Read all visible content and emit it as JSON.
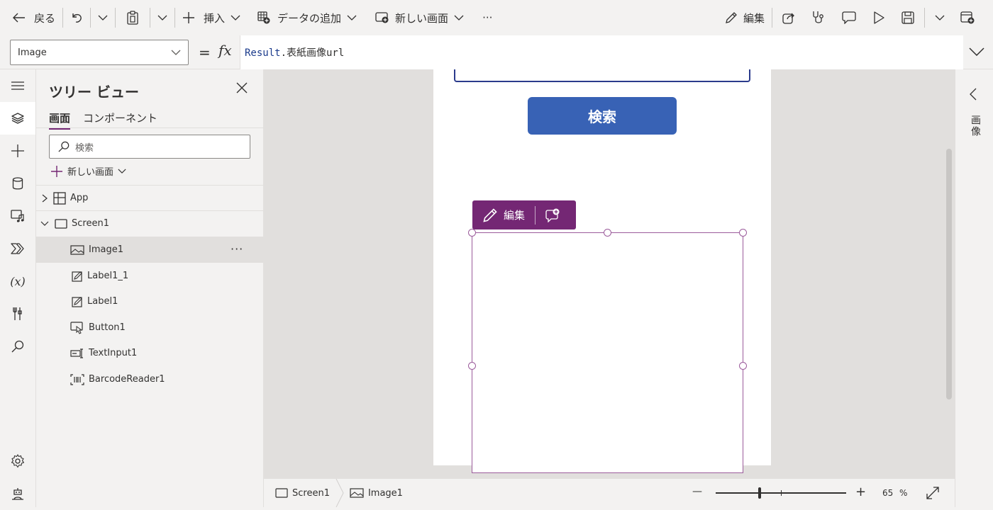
{
  "toolbar": {
    "back_label": "戻る",
    "insert_label": "挿入",
    "add_data_label": "データの追加",
    "new_screen_label": "新しい画面",
    "more_label": "···",
    "edit_label": "編集"
  },
  "formula_bar": {
    "property": "Image",
    "equals": "=",
    "fx": "fx",
    "formula_object": "Result",
    "formula_rest": ".表紙画像url"
  },
  "tree_view": {
    "title": "ツリー ビュー",
    "tabs": [
      {
        "label": "画面",
        "active": true
      },
      {
        "label": "コンポーネント",
        "active": false
      }
    ],
    "search_placeholder": "検索",
    "new_screen_label": "新しい画面",
    "nodes": [
      {
        "label": "App",
        "icon": "app-icon",
        "expanded": false
      },
      {
        "label": "Screen1",
        "icon": "screen-icon",
        "expanded": true
      },
      {
        "label": "Image1",
        "icon": "image-icon",
        "selected": true
      },
      {
        "label": "Label1_1",
        "icon": "label-icon"
      },
      {
        "label": "Label1",
        "icon": "label-icon"
      },
      {
        "label": "Button1",
        "icon": "button-icon"
      },
      {
        "label": "TextInput1",
        "icon": "textinput-icon"
      },
      {
        "label": "BarcodeReader1",
        "icon": "barcode-icon"
      }
    ],
    "more_label": "···"
  },
  "canvas": {
    "search_button_label": "検索",
    "edit_pill_label": "編集"
  },
  "right_pane": {
    "label": "画像"
  },
  "status_bar": {
    "breadcrumb_screen": "Screen1",
    "breadcrumb_image": "Image1",
    "zoom_minus": "—",
    "zoom_plus": "+",
    "zoom_value": "65",
    "zoom_unit": "%"
  },
  "colors": {
    "accent": "#742774",
    "button_blue": "#3862b5",
    "input_border": "#2b3b8c",
    "canvas_bg": "#e1dfdd"
  }
}
